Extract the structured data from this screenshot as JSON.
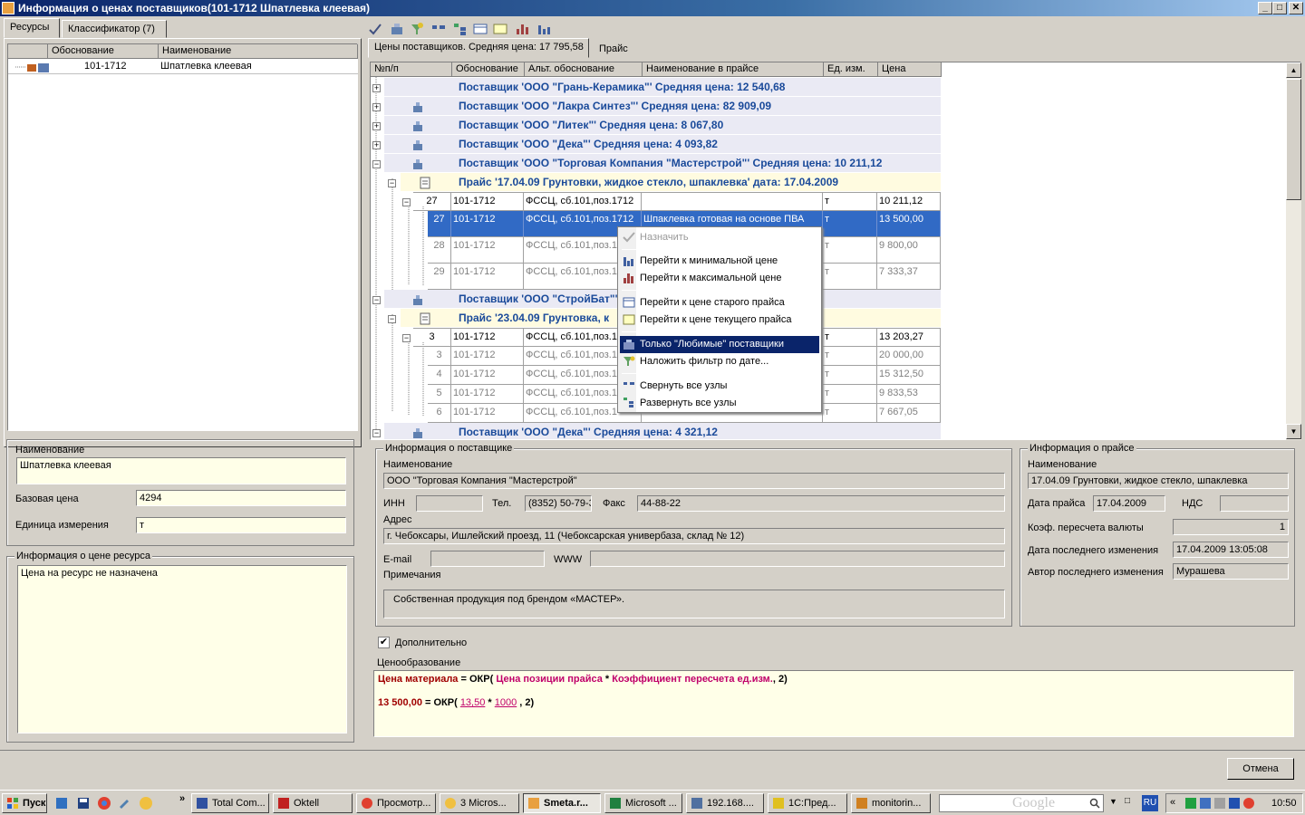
{
  "window": {
    "title": "Информация о ценах поставщиков(101-1712  Шпатлевка клеевая)",
    "minimize": "_",
    "maximize": "□",
    "close": "✕"
  },
  "left_tabs": [
    "Ресурсы",
    "Классификатор (7)"
  ],
  "resource_table": {
    "columns": [
      "Обоснование",
      "Наименование"
    ],
    "row": {
      "code": "101-1712",
      "name": "Шпатлевка клеевая"
    }
  },
  "resource_form": {
    "name_label": "Наименование",
    "name_value": "Шпатлевка клеевая",
    "base_price_label": "Базовая цена",
    "base_price_value": "4294",
    "unit_label": "Единица измерения",
    "unit_value": "т"
  },
  "resource_price_info": {
    "title": "Информация о цене ресурса",
    "text": "Цена на ресурс не назначена"
  },
  "right_tabs": [
    "Цены поставщиков. Средняя цена: 17 795,58",
    "Прайс"
  ],
  "grid": {
    "columns": [
      "№п/п",
      "Обоснование",
      "Альт. обоснование",
      "Наименование в прайсе",
      "Ед. изм.",
      "Цена"
    ],
    "suppliers": [
      "Поставщик 'ООО \"Грань-Керамика\"' Средняя цена: 12 540,68",
      "Поставщик 'ООО \"Лакра Синтез\"' Средняя цена: 82 909,09",
      "Поставщик 'ООО \"Литек\"' Средняя цена: 8 067,80",
      "Поставщик 'ООО \"Дека\"' Средняя цена: 4 093,82",
      "Поставщик 'ООО \"Торговая Компания \"Мастерстрой\"' Средняя цена: 10 211,12"
    ],
    "price1": "Прайс '17.04.09 Грунтовки, жидкое стекло, шпаклевка' дата: 17.04.2009",
    "rows1": [
      {
        "n": "27",
        "code": "101-1712",
        "alt": "ФССЦ, сб.101,поз.1712",
        "name": "",
        "unit": "т",
        "price": "10 211,12"
      },
      {
        "n": "27",
        "code": "101-1712",
        "alt": "ФССЦ, сб.101,поз.1712",
        "name": "Шпаклевка готовая на основе ПВА",
        "unit": "т",
        "price": "13 500,00"
      },
      {
        "n": "28",
        "code": "101-1712",
        "alt": "ФССЦ, сб.101,поз.1",
        "name": "",
        "unit": "т",
        "price": "9 800,00"
      },
      {
        "n": "29",
        "code": "101-1712",
        "alt": "ФССЦ, сб.101,поз.1",
        "name": "",
        "unit": "т",
        "price": "7 333,37"
      }
    ],
    "supplier6": "Поставщик 'ООО \"СтройБат\"'",
    "price2": "Прайс '23.04.09 Грунтовка, к",
    "rows2": [
      {
        "n": "3",
        "code": "101-1712",
        "alt": "ФССЦ, сб.101,поз.1",
        "name": "",
        "unit": "т",
        "price": "13 203,27"
      },
      {
        "n": "3",
        "code": "101-1712",
        "alt": "ФССЦ, сб.101,поз.1",
        "name": "",
        "unit": "т",
        "price": "20 000,00"
      },
      {
        "n": "4",
        "code": "101-1712",
        "alt": "ФССЦ, сб.101,поз.1",
        "name": "",
        "unit": "т",
        "price": "15 312,50"
      },
      {
        "n": "5",
        "code": "101-1712",
        "alt": "ФССЦ, сб.101,поз.1",
        "name": "",
        "unit": "т",
        "price": "9 833,53"
      },
      {
        "n": "6",
        "code": "101-1712",
        "alt": "ФССЦ, сб.101,поз.1",
        "name": "",
        "unit": "т",
        "price": "7 667,05"
      }
    ],
    "supplier7": "Поставщик 'ООО \"Дека\"' Средняя цена: 4 321,12"
  },
  "context_menu": [
    "Назначить",
    "Перейти к минимальной цене",
    "Перейти к максимальной цене",
    "Перейти к цене старого прайса",
    "Перейти к цене текущего прайса",
    "Только \"Любимые\" поставщики",
    "Наложить фильтр по дате...",
    "Свернуть все узлы",
    "Развернуть все узлы"
  ],
  "supplier_info": {
    "title": "Информация о поставщике",
    "name_label": "Наименование",
    "name_value": "ООО \"Торговая Компания \"Мастерстрой\"",
    "inn_label": "ИНН",
    "inn_value": "",
    "tel_label": "Тел.",
    "tel_value": "(8352) 50-79-3",
    "fax_label": "Факс",
    "fax_value": "44-88-22",
    "address_label": "Адрес",
    "address_value": "г. Чебоксары, Ишлейский проезд, 11 (Чебоксарская универбаза, склад № 12)",
    "email_label": "E-mail",
    "www_label": "WWW",
    "notes_label": "Примечания",
    "notes_value": "Собственная  продукция под брендом «МАСТЕР»."
  },
  "price_info": {
    "title": "Информация о прайсе",
    "name_label": "Наименование",
    "name_value": "17.04.09 Грунтовки, жидкое стекло, шпаклевка",
    "date_label": "Дата прайса",
    "date_value": "17.04.2009",
    "vat_label": "НДС",
    "vat_value": "",
    "rate_label": "Коэф. пересчета валюты",
    "rate_value": "1",
    "lastmod_label": "Дата последнего изменения",
    "lastmod_value": "17.04.2009 13:05:08",
    "author_label": "Автор последнего изменения",
    "author_value": "Мурашева"
  },
  "additional_label": "Дополнительно",
  "pricing": {
    "title": "Ценообразование",
    "f1_a": "Цена материала",
    "f1_b": " = ОКР( ",
    "f1_c": "Цена позиции прайса",
    "f1_d": " * ",
    "f1_e": "Коэффициент пересчета ед.изм.",
    "f1_f": ", 2)",
    "f2_a": "13 500,00",
    "f2_b": " = ОКР( ",
    "f2_c": "13,50",
    "f2_d": " * ",
    "f2_e": "1000",
    "f2_f": " , 2)"
  },
  "cancel_button": "Отмена",
  "taskbar": {
    "start": "Пуск",
    "tasks": [
      "Total Com...",
      "Oktell",
      "Просмотр...",
      "3 Micros...",
      "Smeta.r...",
      "Microsoft ...",
      "192.168....",
      "1С:Пред...",
      "monitorin..."
    ],
    "lang": "RU",
    "clock": "10:50",
    "search_placeholder": "Google",
    "chevron": "»",
    "tray_chevron": "«"
  },
  "colors": {
    "selection": "#316ac5",
    "supplier_text": "#1a4a9a",
    "formula_red": "#a00000",
    "formula_magenta": "#c0006a",
    "menu_highlight": "#0a246a"
  }
}
